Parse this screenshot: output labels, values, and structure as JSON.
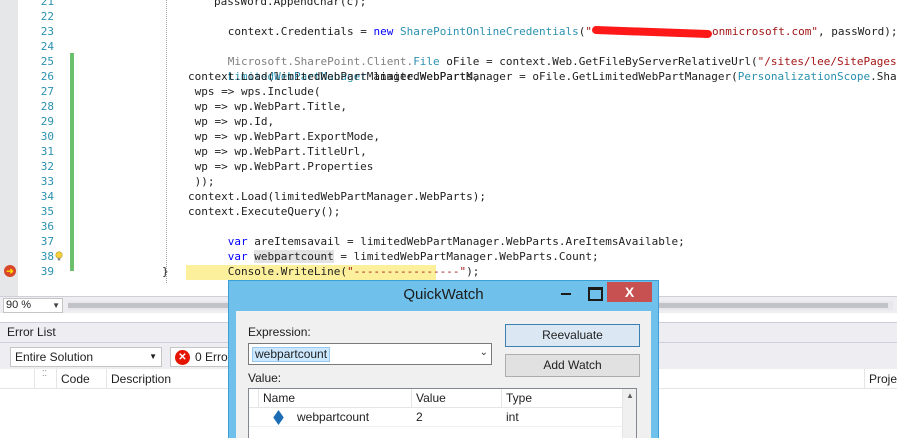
{
  "editor": {
    "lines": [
      {
        "n": "21",
        "text": "passWord.AppendChar(c);",
        "indent": 4
      },
      {
        "n": "22",
        "text": "context.Credentials = new SharePointOnlineCredentials(\"",
        "tail": "onmicrosoft.com\", passWord);",
        "indent": 3
      },
      {
        "n": "23",
        "text": "",
        "indent": 3
      },
      {
        "n": "24",
        "text": "Microsoft.SharePoint.Client.File oFile = context.Web.GetFileByServerRelativeUrl(\"/sites/lee/SitePages/wp.aspx\");",
        "indent": 3
      },
      {
        "n": "25",
        "text": "LimitedWebPartManager limitedWebPartManager = oFile.GetLimitedWebPartManager(PersonalizationScope.Shared);",
        "indent": 3
      },
      {
        "n": "26",
        "text": "context.Load(limitedWebPartManager.WebParts,",
        "indent": 3
      },
      {
        "n": "27",
        "text": " wps => wps.Include(",
        "indent": 3
      },
      {
        "n": "28",
        "text": " wp => wp.WebPart.Title,",
        "indent": 3
      },
      {
        "n": "29",
        "text": " wp => wp.Id,",
        "indent": 3
      },
      {
        "n": "30",
        "text": " wp => wp.WebPart.ExportMode,",
        "indent": 3
      },
      {
        "n": "31",
        "text": " wp => wp.WebPart.TitleUrl,",
        "indent": 3
      },
      {
        "n": "32",
        "text": " wp => wp.WebPart.Properties",
        "indent": 3
      },
      {
        "n": "33",
        "text": " ));",
        "indent": 3
      },
      {
        "n": "34",
        "text": "context.Load(limitedWebPartManager.WebParts);",
        "indent": 3
      },
      {
        "n": "35",
        "text": "context.ExecuteQuery();",
        "indent": 3
      },
      {
        "n": "36",
        "text": "var areItemsavail = limitedWebPartManager.WebParts.AreItemsAvailable;",
        "indent": 3
      },
      {
        "n": "37",
        "text": "var webpartcount = limitedWebPartManager.WebParts.Count;",
        "indent": 3
      },
      {
        "n": "38",
        "text": "Console.WriteLine(\"----------------\");",
        "indent": 3
      },
      {
        "n": "39",
        "text": "}",
        "indent": 2
      }
    ]
  },
  "zoom": {
    "value": "90 %"
  },
  "error_list": {
    "title": "Error List",
    "scope": "Entire Solution",
    "errors_label": "0 Errors",
    "columns": {
      "code": "Code",
      "description": "Description",
      "project": "Proje"
    }
  },
  "quickwatch": {
    "title": "QuickWatch",
    "close_glyph": "X",
    "expression_label": "Expression:",
    "expression_value": "webpartcount",
    "reevaluate_label": "Reevaluate",
    "add_watch_label": "Add Watch",
    "value_label": "Value:",
    "columns": {
      "name": "Name",
      "value": "Value",
      "type": "Type"
    },
    "rows": [
      {
        "name": "webpartcount",
        "value": "2",
        "type": "int"
      }
    ]
  },
  "colors": {
    "keyword": "#0000ff",
    "type": "#2b91af",
    "string": "#a31515",
    "exec_highlight": "#fdf09c",
    "dialog_frame": "#6fc0ea",
    "close_button": "#c75050"
  }
}
